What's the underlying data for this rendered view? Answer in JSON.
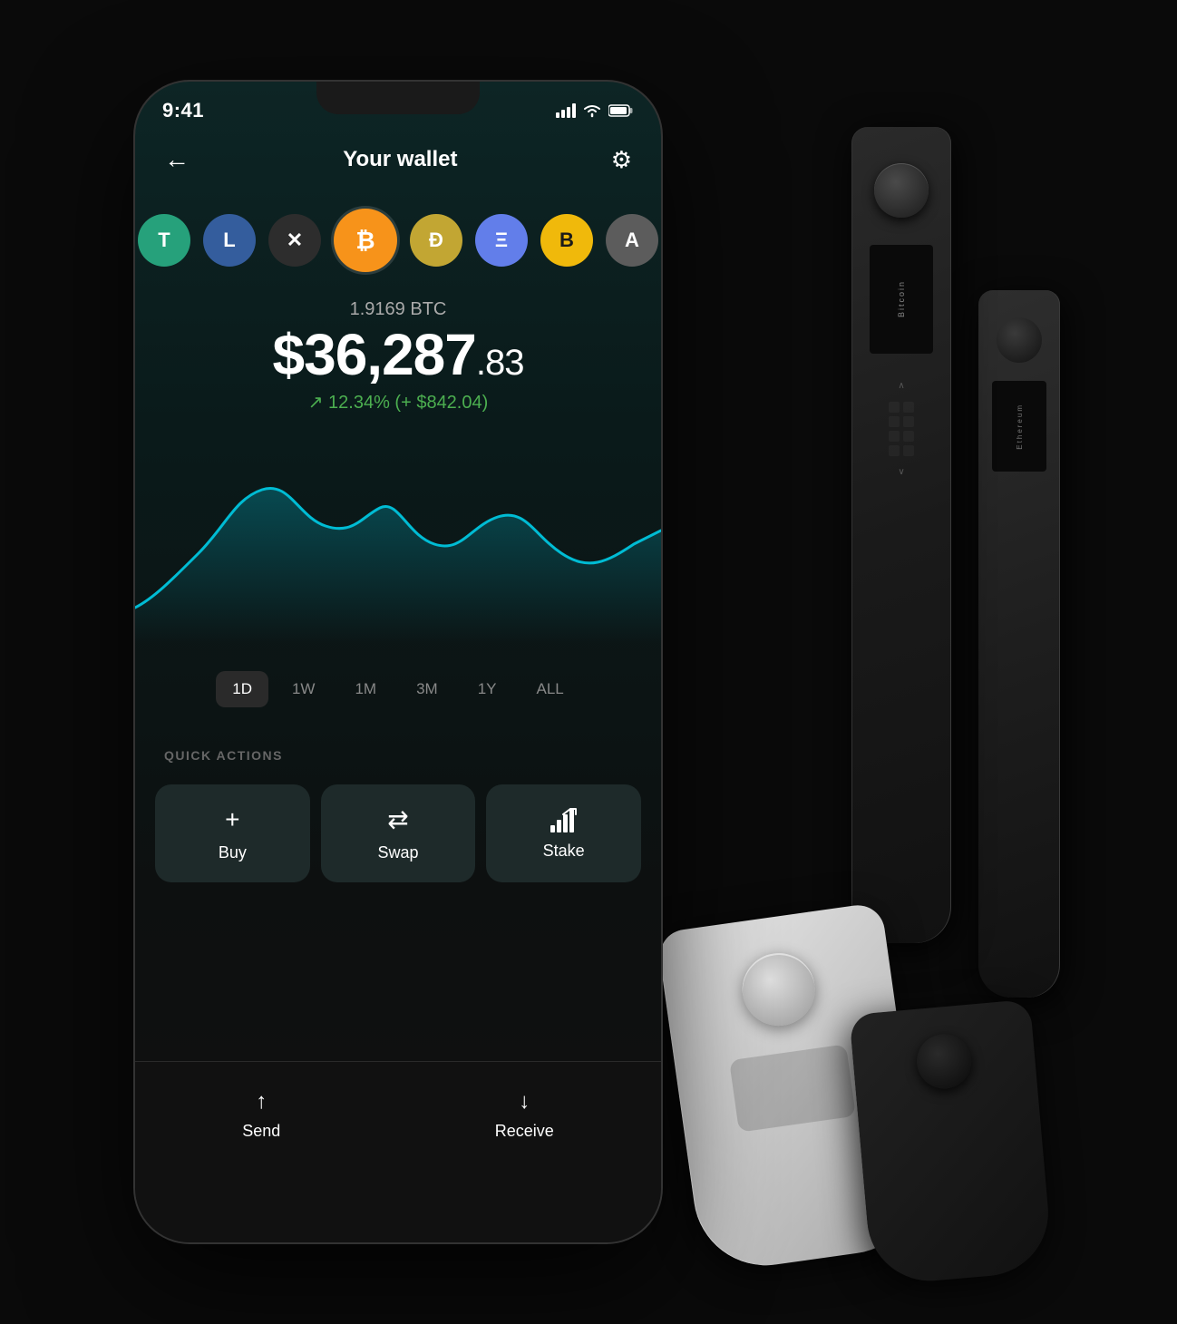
{
  "status_bar": {
    "time": "9:41",
    "signal_icon": "▲▲▲▲",
    "wifi_icon": "WiFi",
    "battery_icon": "Battery"
  },
  "header": {
    "back_label": "←",
    "title": "Your wallet",
    "settings_icon": "⚙"
  },
  "coins": [
    {
      "symbol": "T",
      "name": "tether",
      "class": "coin-tether"
    },
    {
      "symbol": "L",
      "name": "litecoin",
      "class": "coin-litecoin"
    },
    {
      "symbol": "✕",
      "name": "xrp",
      "class": "coin-xrp"
    },
    {
      "symbol": "₿",
      "name": "bitcoin",
      "class": "coin-bitcoin"
    },
    {
      "symbol": "Ð",
      "name": "dogecoin",
      "class": "coin-doge"
    },
    {
      "symbol": "Ξ",
      "name": "ethereum",
      "class": "coin-ethereum"
    },
    {
      "symbol": "B",
      "name": "bnb",
      "class": "coin-bnb"
    },
    {
      "symbol": "A",
      "name": "algo",
      "class": "coin-partial"
    }
  ],
  "balance": {
    "crypto_amount": "1.9169 BTC",
    "fiat_whole": "$36,287",
    "fiat_cents": ".83",
    "change_percent": "↗ 12.34% (+ $842.04)"
  },
  "time_periods": [
    {
      "label": "1D",
      "active": true
    },
    {
      "label": "1W",
      "active": false
    },
    {
      "label": "1M",
      "active": false
    },
    {
      "label": "3M",
      "active": false
    },
    {
      "label": "1Y",
      "active": false
    },
    {
      "label": "ALL",
      "active": false
    }
  ],
  "quick_actions": {
    "label": "QUICK ACTIONS",
    "buttons": [
      {
        "icon": "+",
        "label": "Buy"
      },
      {
        "icon": "⇄",
        "label": "Swap"
      },
      {
        "icon": "⬆",
        "label": "Stake"
      }
    ]
  },
  "bottom_actions": [
    {
      "icon": "↑",
      "label": "Send"
    },
    {
      "icon": "↓",
      "label": "Receive"
    }
  ],
  "hw_wallets": {
    "wallet1_text": "Bitcoin",
    "wallet2_text": "Ethereum"
  }
}
